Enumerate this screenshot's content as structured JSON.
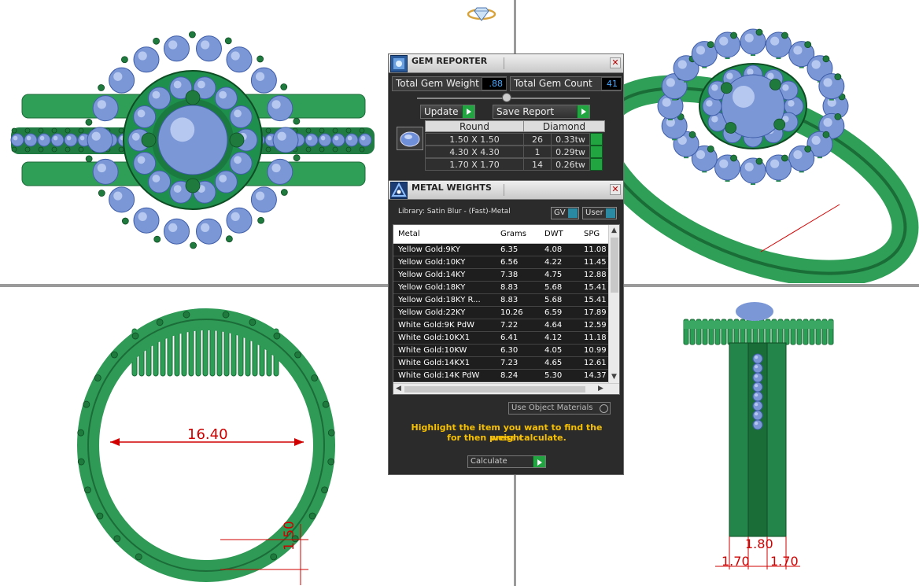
{
  "viewport": {
    "front_diameter": "16.40",
    "front_thickness": "1.50",
    "side_center_width": "1.80",
    "side_left_width": "1.70",
    "side_right_width": "1.70"
  },
  "gem_reporter": {
    "title": "GEM REPORTER",
    "total_weight_label": "Total Gem Weight",
    "total_weight_value": ".88",
    "total_count_label": "Total Gem Count",
    "total_count_value": "41",
    "update_label": "Update",
    "save_report_label": "Save Report",
    "table": {
      "shape": "Round",
      "material": "Diamond",
      "rows": [
        {
          "size": "1.50 X 1.50",
          "count": "26",
          "weight": "0.33tw"
        },
        {
          "size": "4.30 X 4.30",
          "count": "1",
          "weight": "0.29tw"
        },
        {
          "size": "1.70 X 1.70",
          "count": "14",
          "weight": "0.26tw"
        }
      ]
    }
  },
  "metal_weights": {
    "title": "METAL WEIGHTS",
    "library": "Library: Satin Blur - (Fast)-Metal",
    "gv_label": "GV",
    "user_label": "User",
    "columns": [
      "Metal",
      "Grams",
      "DWT",
      "SPG"
    ],
    "rows": [
      {
        "metal": "Yellow Gold:9KY",
        "grams": "6.35",
        "dwt": "4.08",
        "spg": "11.08"
      },
      {
        "metal": "Yellow Gold:10KY",
        "grams": "6.56",
        "dwt": "4.22",
        "spg": "11.45"
      },
      {
        "metal": "Yellow Gold:14KY",
        "grams": "7.38",
        "dwt": "4.75",
        "spg": "12.88"
      },
      {
        "metal": "Yellow Gold:18KY",
        "grams": "8.83",
        "dwt": "5.68",
        "spg": "15.41"
      },
      {
        "metal": "Yellow Gold:18KY R...",
        "grams": "8.83",
        "dwt": "5.68",
        "spg": "15.41"
      },
      {
        "metal": "Yellow Gold:22KY",
        "grams": "10.26",
        "dwt": "6.59",
        "spg": "17.89"
      },
      {
        "metal": "White Gold:9K PdW",
        "grams": "7.22",
        "dwt": "4.64",
        "spg": "12.59"
      },
      {
        "metal": "White Gold:10KX1",
        "grams": "6.41",
        "dwt": "4.12",
        "spg": "11.18"
      },
      {
        "metal": "White Gold:10KW",
        "grams": "6.30",
        "dwt": "4.05",
        "spg": "10.99"
      },
      {
        "metal": "White Gold:14KX1",
        "grams": "7.23",
        "dwt": "4.65",
        "spg": "12.61"
      },
      {
        "metal": "White Gold:14K PdW",
        "grams": "8.24",
        "dwt": "5.30",
        "spg": "14.37"
      }
    ],
    "use_object_materials": "Use Object Materials",
    "hint_line1": "Highlight the item you want to find the weight",
    "hint_line2": "for then press calculate.",
    "calculate_label": "Calculate"
  },
  "colors": {
    "metal_green": "#2f9e57",
    "stone_blue": "#7b97d6",
    "dimension_red": "#d00000",
    "panel_bg": "#2b2b2b",
    "hint_yellow": "#f7c000"
  }
}
